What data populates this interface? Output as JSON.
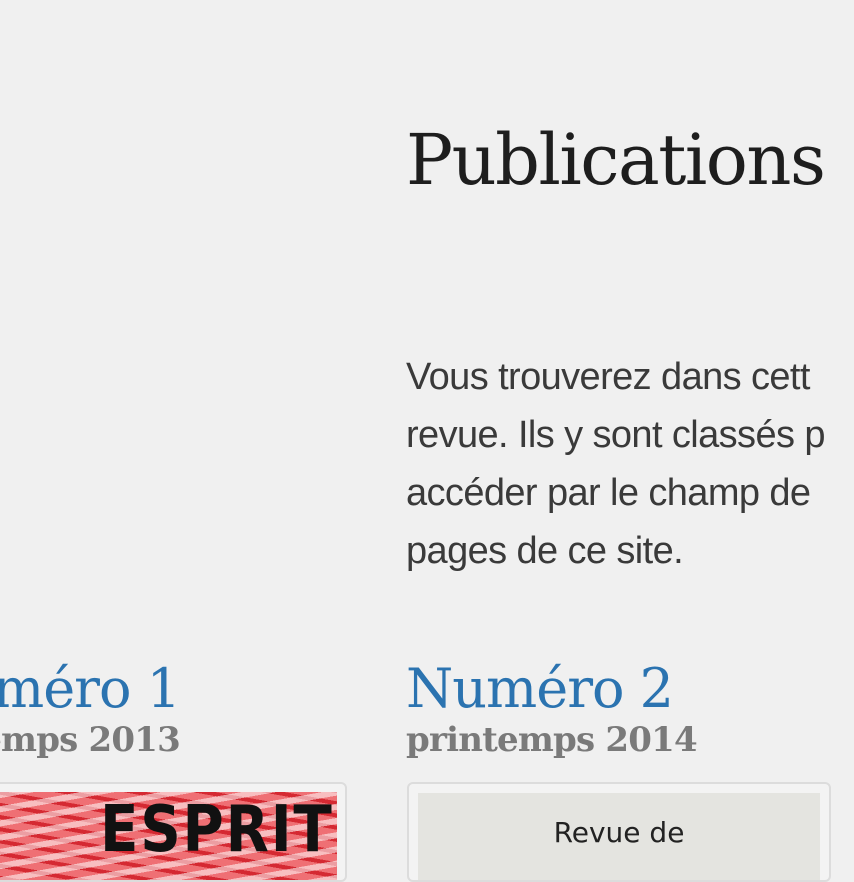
{
  "page": {
    "title": "Publications",
    "intro_lines": [
      "Vous trouverez dans cett",
      "revue. Ils y sont classés p",
      "accéder par le champ de",
      "pages de ce site."
    ]
  },
  "issues": [
    {
      "title": "méro 1",
      "date": "temps 2013",
      "cover_text": "ESPRIT"
    },
    {
      "title": "Numéro 2",
      "date": "printemps 2014",
      "cover_text": "Revue de"
    }
  ],
  "colors": {
    "background": "#f0f0f0",
    "heading": "#1e1e1e",
    "body_text": "#3a3a3a",
    "issue_link": "#2b73b0",
    "issue_date": "#7a7a7a"
  }
}
